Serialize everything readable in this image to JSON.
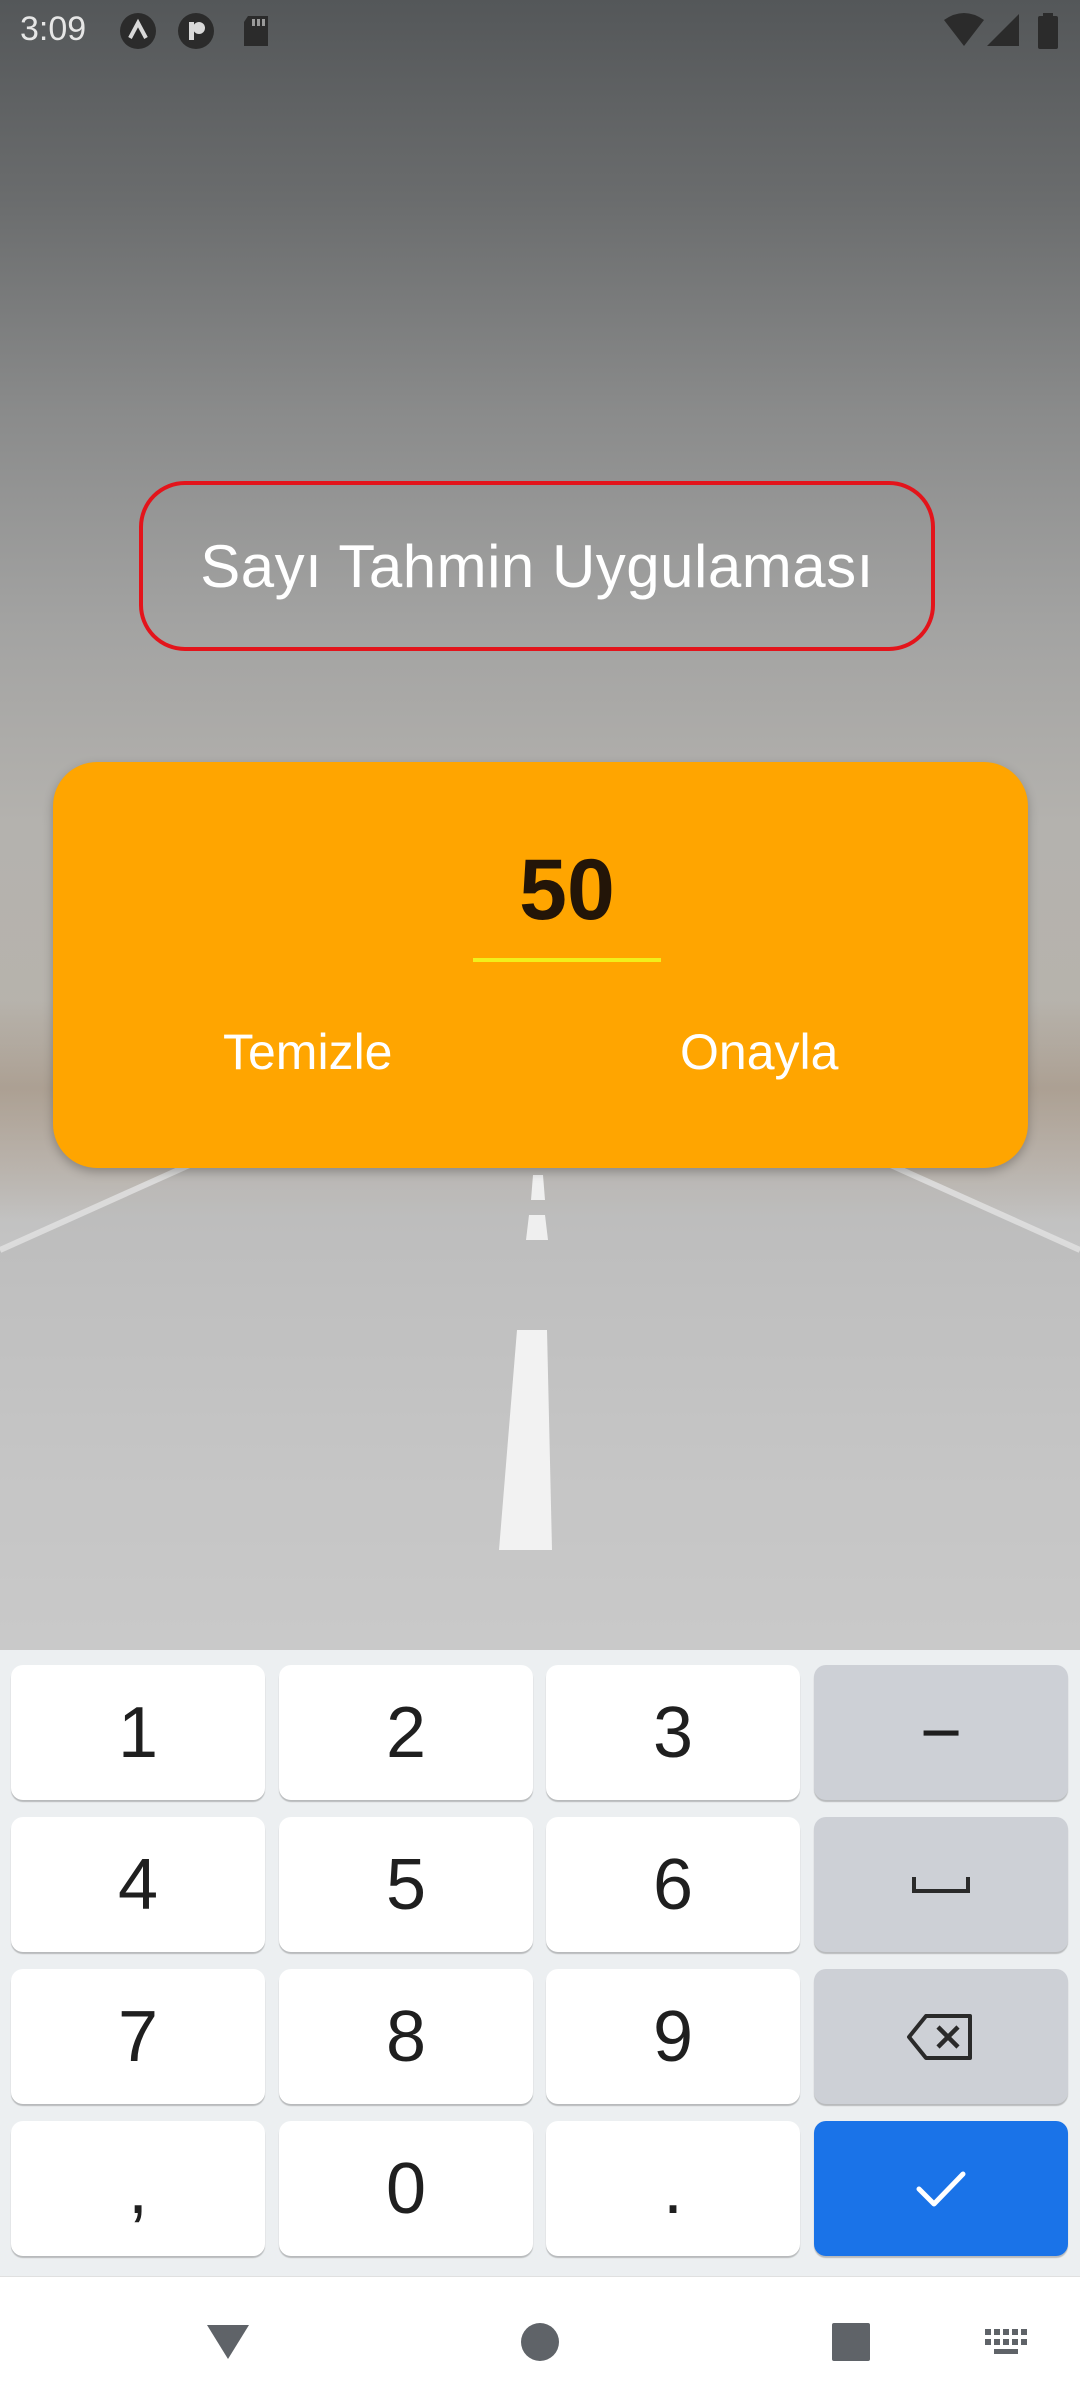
{
  "status_bar": {
    "time": "3:09",
    "left_icons": [
      "a-circle-icon",
      "p-circle-icon",
      "sd-card-icon"
    ],
    "right_icons": [
      "wifi-icon",
      "cell-signal-icon",
      "battery-icon"
    ]
  },
  "app": {
    "title": "Sayı Tahmin Uygulaması",
    "title_border_color": "#e3141b",
    "card_color": "#ffa500",
    "guess_value": "50",
    "clear_label": "Temizle",
    "confirm_label": "Onayla"
  },
  "keyboard": {
    "rows": [
      [
        "1",
        "2",
        "3",
        "−"
      ],
      [
        "4",
        "5",
        "6",
        "space-icon"
      ],
      [
        "7",
        "8",
        "9",
        "backspace-icon"
      ],
      [
        ",",
        "0",
        ".",
        "check-icon"
      ]
    ],
    "enter_color": "#1a73e8"
  },
  "nav_bar": {
    "items": [
      "back-icon",
      "home-icon",
      "recents-icon",
      "keyboard-switch-icon"
    ]
  }
}
